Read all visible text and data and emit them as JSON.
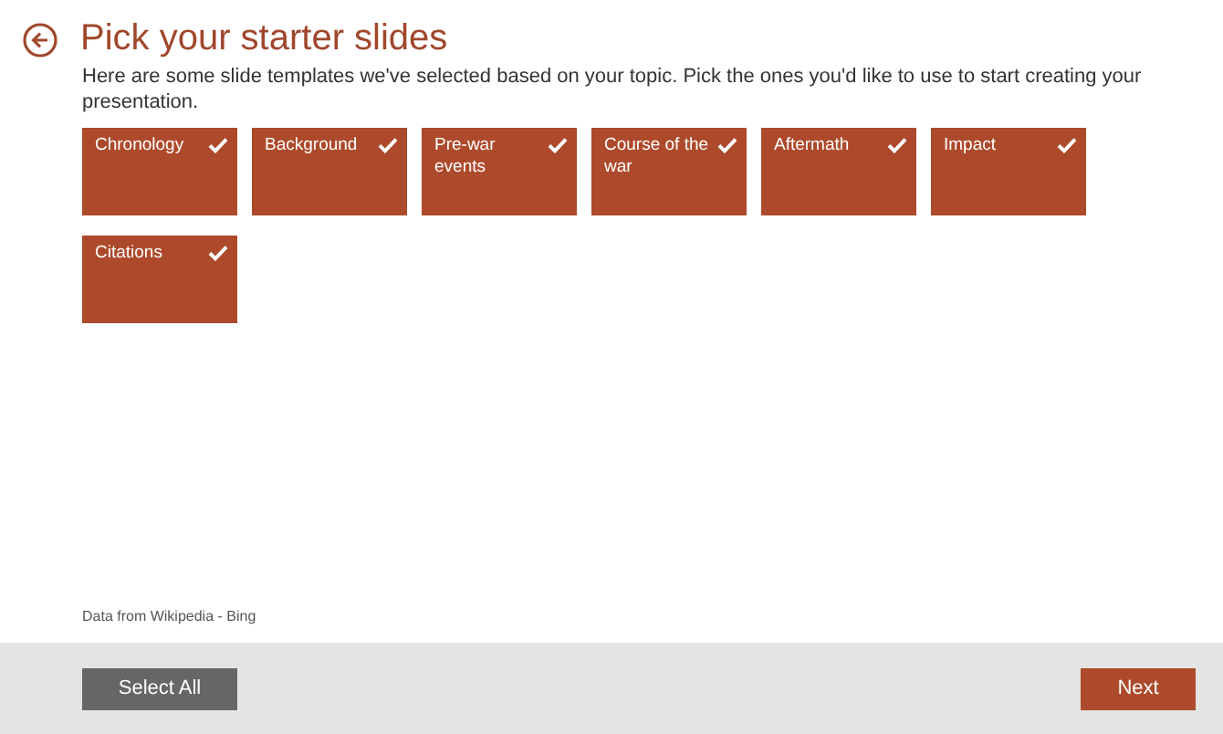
{
  "header": {
    "title": "Pick your starter slides",
    "description": "Here are some slide templates we've selected based on your topic. Pick the ones you'd like to use to start creating your presentation."
  },
  "slides": [
    {
      "label": "Chronology",
      "selected": true
    },
    {
      "label": "Background",
      "selected": true
    },
    {
      "label": "Pre-war events",
      "selected": true
    },
    {
      "label": "Course of the war",
      "selected": true
    },
    {
      "label": "Aftermath",
      "selected": true
    },
    {
      "label": "Impact",
      "selected": true
    },
    {
      "label": "Citations",
      "selected": true
    }
  ],
  "attribution": "Data from Wikipedia - Bing",
  "footer": {
    "select_all": "Select All",
    "next": "Next"
  }
}
